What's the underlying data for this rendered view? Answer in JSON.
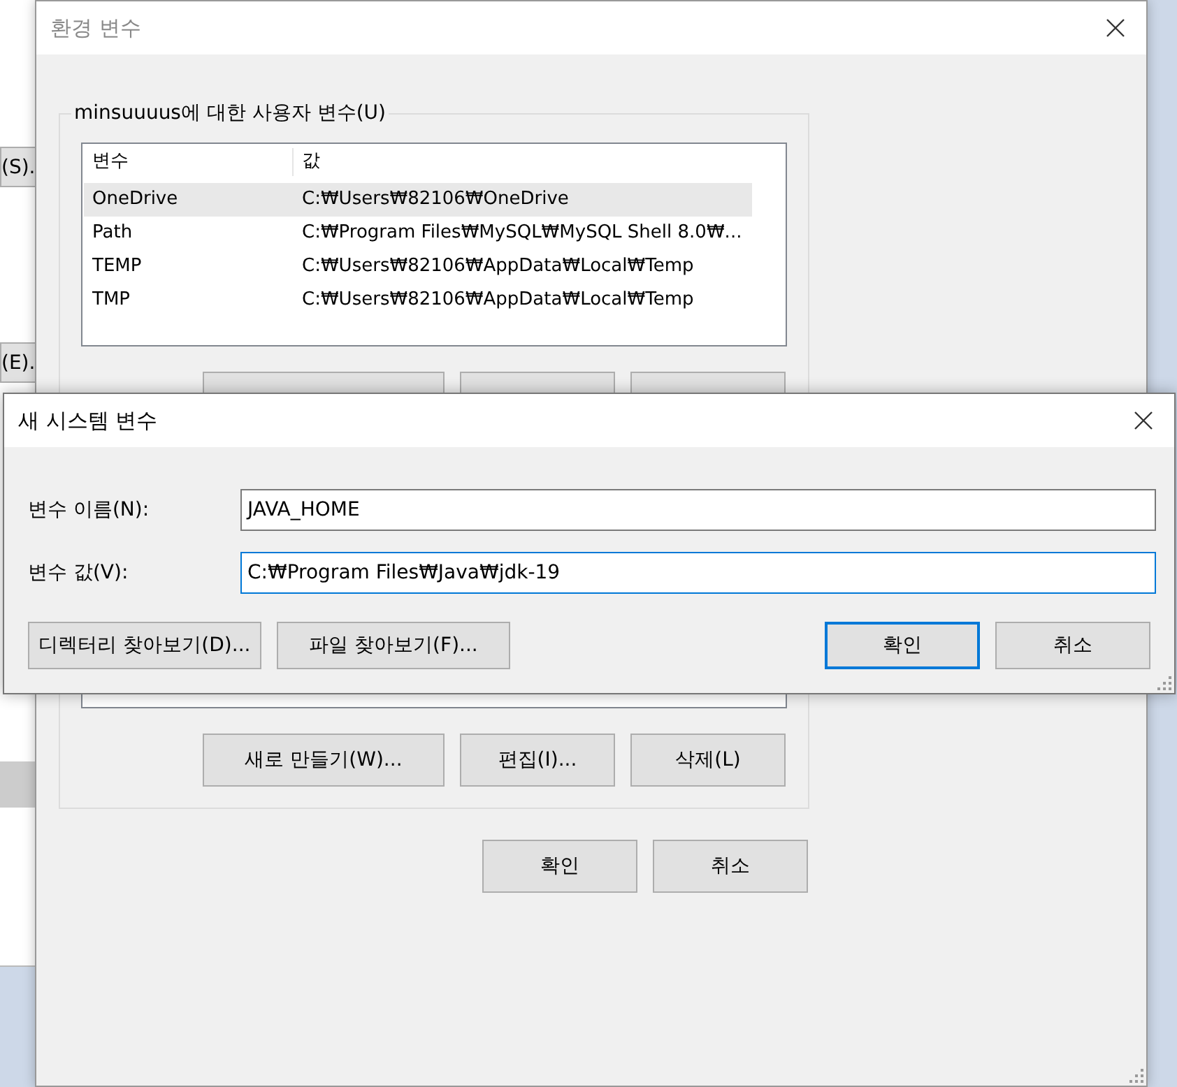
{
  "background_window": {
    "buttons": [
      {
        "label": "(S)."
      },
      {
        "label": "(E)."
      }
    ]
  },
  "env_window": {
    "title": "환경 변수",
    "user_variables": {
      "label": "minsuuuus에 대한 사용자 변수(U)",
      "columns": [
        "변수",
        "값"
      ],
      "rows": [
        {
          "name": "OneDrive",
          "value": "C:₩Users₩82106₩OneDrive",
          "selected": true
        },
        {
          "name": "Path",
          "value": "C:₩Program Files₩MySQL₩MySQL Shell 8.0₩...",
          "selected": false
        },
        {
          "name": "TEMP",
          "value": "C:₩Users₩82106₩AppData₩Local₩Temp",
          "selected": false
        },
        {
          "name": "TMP",
          "value": "C:₩Users₩82106₩AppData₩Local₩Temp",
          "selected": false
        }
      ]
    },
    "system_variable_buttons": [
      "새로 만들기(W)...",
      "편집(I)...",
      "삭제(L)"
    ],
    "buttons": [
      "확인",
      "취소"
    ]
  },
  "dialog": {
    "title": "새 시스템 변수",
    "fields": [
      {
        "label": "변수 이름(N):",
        "value": "JAVA_HOME",
        "focused": false
      },
      {
        "label": "변수 값(V):",
        "value": "C:₩Program Files₩Java₩jdk-19",
        "focused": true
      }
    ],
    "browse_buttons": [
      "디렉터리 찾아보기(D)...",
      "파일 찾아보기(F)..."
    ],
    "buttons": [
      {
        "label": "확인",
        "default": true
      },
      {
        "label": "취소",
        "default": false
      }
    ]
  }
}
